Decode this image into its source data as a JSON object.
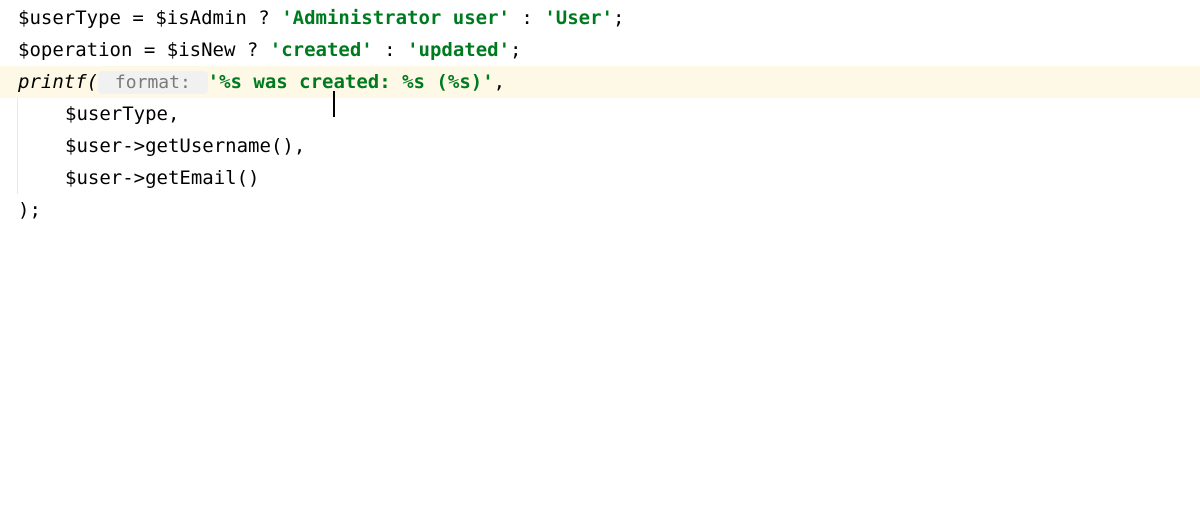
{
  "editor": {
    "lines": [
      {
        "id": "line1",
        "highlighted": false,
        "tokens": {
          "t0": "$userType",
          "t1": " ",
          "t2": "=",
          "t3": " ",
          "t4": "$isAdmin",
          "t5": " ",
          "t6": "?",
          "t7": " ",
          "t8": "'Administrator user'",
          "t9": " ",
          "t10": ":",
          "t11": " ",
          "t12": "'User'",
          "t13": ";"
        }
      },
      {
        "id": "line2",
        "highlighted": false,
        "tokens": {
          "t0": "$operation",
          "t1": " ",
          "t2": "=",
          "t3": " ",
          "t4": "$isNew",
          "t5": " ",
          "t6": "?",
          "t7": " ",
          "t8": "'created'",
          "t9": " ",
          "t10": ":",
          "t11": " ",
          "t12": "'updated'",
          "t13": ";"
        }
      },
      {
        "id": "line3",
        "highlighted": true,
        "tokens": {
          "t0": "printf",
          "t1": "(",
          "hint": " format: ",
          "t2": "'%s was cre",
          "t3": "ated: %s (%s)'",
          "t4": ","
        }
      },
      {
        "id": "line4",
        "highlighted": false,
        "tokens": {
          "t0": "$userType",
          "t1": ","
        }
      },
      {
        "id": "line5",
        "highlighted": false,
        "tokens": {
          "t0": "$user",
          "t1": "->",
          "t2": "getUsername",
          "t3": "(),"
        }
      },
      {
        "id": "line6",
        "highlighted": false,
        "tokens": {
          "t0": "$user",
          "t1": "->",
          "t2": "getEmail",
          "t3": "()"
        }
      },
      {
        "id": "line7",
        "highlighted": false,
        "tokens": {
          "t0": ");"
        }
      }
    ]
  }
}
